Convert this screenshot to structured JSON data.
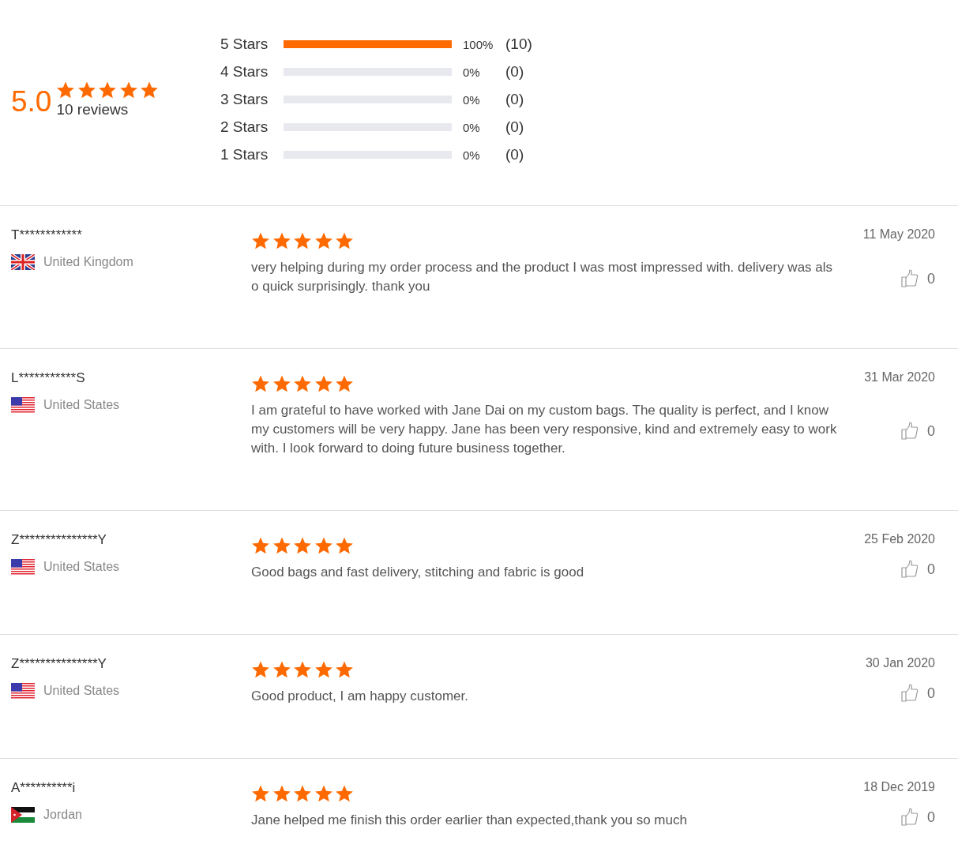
{
  "summary": {
    "score": "5.0",
    "stars": 5,
    "count": "10 reviews",
    "distribution": [
      {
        "label": "5 Stars",
        "level": 1,
        "percent": "100%",
        "count": "(10)"
      },
      {
        "label": "4 Stars",
        "level": 0,
        "percent": "0%",
        "count": "(0)"
      },
      {
        "label": "3 Stars",
        "level": 0,
        "percent": "0%",
        "count": "(0)"
      },
      {
        "label": "2 Stars",
        "level": 0,
        "percent": "0%",
        "count": "(0)"
      },
      {
        "label": "1 Stars",
        "level": 0,
        "percent": "0%",
        "count": "(0)"
      }
    ]
  },
  "reviews": [
    {
      "name": "T************",
      "kind": "uk",
      "country": "United Kingdom",
      "stars": 5,
      "text": "very helping during my order process and the product I was most impressed with. delivery was also quick surprisingly. thank you",
      "date": "11 May 2020",
      "likes": "0"
    },
    {
      "name": "L***********S",
      "kind": "us",
      "country": "United States",
      "stars": 5,
      "text": "I am grateful to have worked with Jane Dai on my custom bags. The quality is perfect, and I know  my customers will be very happy. Jane has been very responsive, kind and extremely easy to work with. I look forward to doing future business together.",
      "date": "31 Mar 2020",
      "likes": "0"
    },
    {
      "name": "Z***************Y",
      "kind": "us",
      "country": "United States",
      "stars": 5,
      "text": "Good bags and fast delivery, stitching and fabric is good",
      "date": "25 Feb 2020",
      "likes": "0"
    },
    {
      "name": "Z***************Y",
      "kind": "us",
      "country": "United States",
      "stars": 5,
      "text": "Good product, I am happy customer.",
      "date": "30 Jan 2020",
      "likes": "0"
    },
    {
      "name": "A**********i",
      "kind": "jordan",
      "country": "Jordan",
      "stars": 5,
      "text": "Jane helped me finish this order earlier than expected,thank you so much",
      "date": "18 Dec 2019",
      "likes": "0"
    }
  ]
}
